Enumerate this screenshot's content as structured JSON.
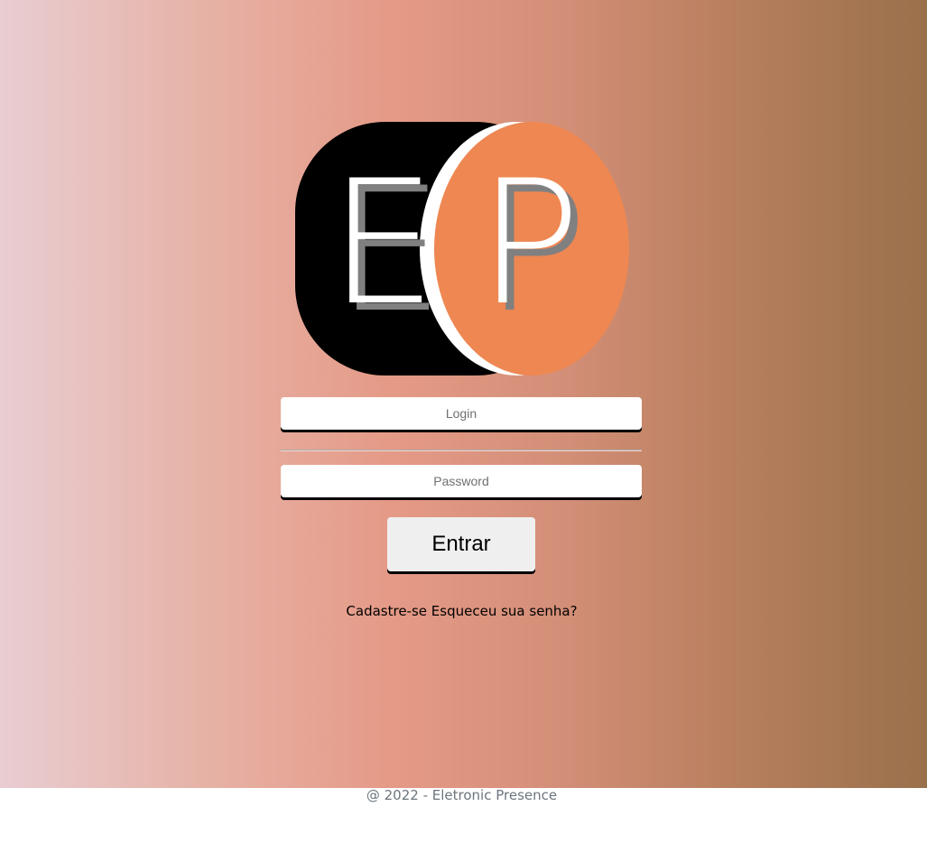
{
  "logo": {
    "letter_left": "E",
    "letter_right": "P",
    "left_color": "#000000",
    "right_color": "#ee8752",
    "letter_color": "#ffffff",
    "shadow_color": "#808080"
  },
  "form": {
    "login_placeholder": "Login",
    "password_placeholder": "Password",
    "submit_label": "Entrar"
  },
  "links": {
    "register": "Cadastre-se",
    "forgot_password": "Esqueceu sua senha?"
  },
  "footer": {
    "copyright": "@ 2022 - Eletronic Presence"
  }
}
